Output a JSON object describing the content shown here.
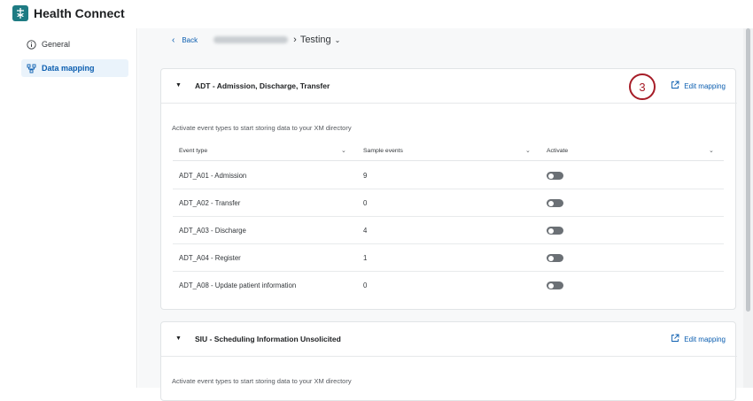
{
  "app": {
    "title": "Health Connect"
  },
  "sidebar": {
    "items": [
      {
        "label": "General",
        "icon": "info-icon"
      },
      {
        "label": "Data mapping",
        "icon": "data-mapping-icon"
      }
    ]
  },
  "breadcrumb": {
    "back_label": "Back",
    "current": "Testing"
  },
  "columns": [
    "Event type",
    "Sample events",
    "Activate"
  ],
  "sections": [
    {
      "title": "ADT - Admission, Discharge, Transfer",
      "edit_label": "Edit mapping",
      "description": "Activate event types to start storing data to your XM directory",
      "rows": [
        {
          "event": "ADT_A01 - Admission",
          "samples": "9",
          "active": false
        },
        {
          "event": "ADT_A02 - Transfer",
          "samples": "0",
          "active": false
        },
        {
          "event": "ADT_A03 - Discharge",
          "samples": "4",
          "active": false
        },
        {
          "event": "ADT_A04 - Register",
          "samples": "1",
          "active": false
        },
        {
          "event": "ADT_A08 - Update patient information",
          "samples": "0",
          "active": false
        }
      ]
    },
    {
      "title": "SIU - Scheduling Information Unsolicited",
      "edit_label": "Edit mapping",
      "description": "Activate event types to start storing data to your XM directory"
    }
  ],
  "callout": {
    "number": "3"
  },
  "colors": {
    "accent": "#0b5eb0",
    "brand": "#1e7b83",
    "callout": "#a61c27"
  }
}
